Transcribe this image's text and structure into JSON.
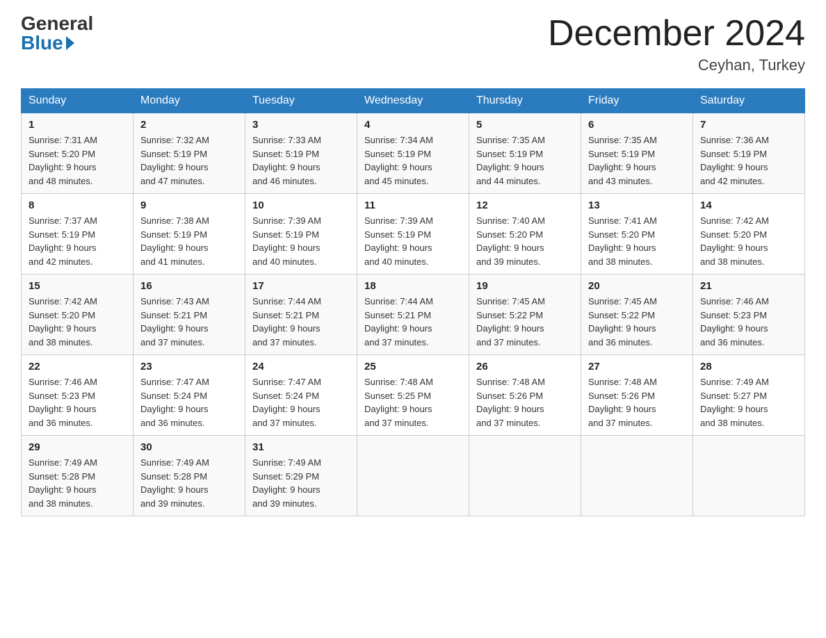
{
  "logo": {
    "general": "General",
    "blue": "Blue"
  },
  "header": {
    "month": "December 2024",
    "location": "Ceyhan, Turkey"
  },
  "days_of_week": [
    "Sunday",
    "Monday",
    "Tuesday",
    "Wednesday",
    "Thursday",
    "Friday",
    "Saturday"
  ],
  "weeks": [
    [
      {
        "day": "1",
        "sunrise": "7:31 AM",
        "sunset": "5:20 PM",
        "daylight": "9 hours and 48 minutes."
      },
      {
        "day": "2",
        "sunrise": "7:32 AM",
        "sunset": "5:19 PM",
        "daylight": "9 hours and 47 minutes."
      },
      {
        "day": "3",
        "sunrise": "7:33 AM",
        "sunset": "5:19 PM",
        "daylight": "9 hours and 46 minutes."
      },
      {
        "day": "4",
        "sunrise": "7:34 AM",
        "sunset": "5:19 PM",
        "daylight": "9 hours and 45 minutes."
      },
      {
        "day": "5",
        "sunrise": "7:35 AM",
        "sunset": "5:19 PM",
        "daylight": "9 hours and 44 minutes."
      },
      {
        "day": "6",
        "sunrise": "7:35 AM",
        "sunset": "5:19 PM",
        "daylight": "9 hours and 43 minutes."
      },
      {
        "day": "7",
        "sunrise": "7:36 AM",
        "sunset": "5:19 PM",
        "daylight": "9 hours and 42 minutes."
      }
    ],
    [
      {
        "day": "8",
        "sunrise": "7:37 AM",
        "sunset": "5:19 PM",
        "daylight": "9 hours and 42 minutes."
      },
      {
        "day": "9",
        "sunrise": "7:38 AM",
        "sunset": "5:19 PM",
        "daylight": "9 hours and 41 minutes."
      },
      {
        "day": "10",
        "sunrise": "7:39 AM",
        "sunset": "5:19 PM",
        "daylight": "9 hours and 40 minutes."
      },
      {
        "day": "11",
        "sunrise": "7:39 AM",
        "sunset": "5:19 PM",
        "daylight": "9 hours and 40 minutes."
      },
      {
        "day": "12",
        "sunrise": "7:40 AM",
        "sunset": "5:20 PM",
        "daylight": "9 hours and 39 minutes."
      },
      {
        "day": "13",
        "sunrise": "7:41 AM",
        "sunset": "5:20 PM",
        "daylight": "9 hours and 38 minutes."
      },
      {
        "day": "14",
        "sunrise": "7:42 AM",
        "sunset": "5:20 PM",
        "daylight": "9 hours and 38 minutes."
      }
    ],
    [
      {
        "day": "15",
        "sunrise": "7:42 AM",
        "sunset": "5:20 PM",
        "daylight": "9 hours and 38 minutes."
      },
      {
        "day": "16",
        "sunrise": "7:43 AM",
        "sunset": "5:21 PM",
        "daylight": "9 hours and 37 minutes."
      },
      {
        "day": "17",
        "sunrise": "7:44 AM",
        "sunset": "5:21 PM",
        "daylight": "9 hours and 37 minutes."
      },
      {
        "day": "18",
        "sunrise": "7:44 AM",
        "sunset": "5:21 PM",
        "daylight": "9 hours and 37 minutes."
      },
      {
        "day": "19",
        "sunrise": "7:45 AM",
        "sunset": "5:22 PM",
        "daylight": "9 hours and 37 minutes."
      },
      {
        "day": "20",
        "sunrise": "7:45 AM",
        "sunset": "5:22 PM",
        "daylight": "9 hours and 36 minutes."
      },
      {
        "day": "21",
        "sunrise": "7:46 AM",
        "sunset": "5:23 PM",
        "daylight": "9 hours and 36 minutes."
      }
    ],
    [
      {
        "day": "22",
        "sunrise": "7:46 AM",
        "sunset": "5:23 PM",
        "daylight": "9 hours and 36 minutes."
      },
      {
        "day": "23",
        "sunrise": "7:47 AM",
        "sunset": "5:24 PM",
        "daylight": "9 hours and 36 minutes."
      },
      {
        "day": "24",
        "sunrise": "7:47 AM",
        "sunset": "5:24 PM",
        "daylight": "9 hours and 37 minutes."
      },
      {
        "day": "25",
        "sunrise": "7:48 AM",
        "sunset": "5:25 PM",
        "daylight": "9 hours and 37 minutes."
      },
      {
        "day": "26",
        "sunrise": "7:48 AM",
        "sunset": "5:26 PM",
        "daylight": "9 hours and 37 minutes."
      },
      {
        "day": "27",
        "sunrise": "7:48 AM",
        "sunset": "5:26 PM",
        "daylight": "9 hours and 37 minutes."
      },
      {
        "day": "28",
        "sunrise": "7:49 AM",
        "sunset": "5:27 PM",
        "daylight": "9 hours and 38 minutes."
      }
    ],
    [
      {
        "day": "29",
        "sunrise": "7:49 AM",
        "sunset": "5:28 PM",
        "daylight": "9 hours and 38 minutes."
      },
      {
        "day": "30",
        "sunrise": "7:49 AM",
        "sunset": "5:28 PM",
        "daylight": "9 hours and 39 minutes."
      },
      {
        "day": "31",
        "sunrise": "7:49 AM",
        "sunset": "5:29 PM",
        "daylight": "9 hours and 39 minutes."
      },
      null,
      null,
      null,
      null
    ]
  ],
  "labels": {
    "sunrise": "Sunrise:",
    "sunset": "Sunset:",
    "daylight": "Daylight:"
  }
}
